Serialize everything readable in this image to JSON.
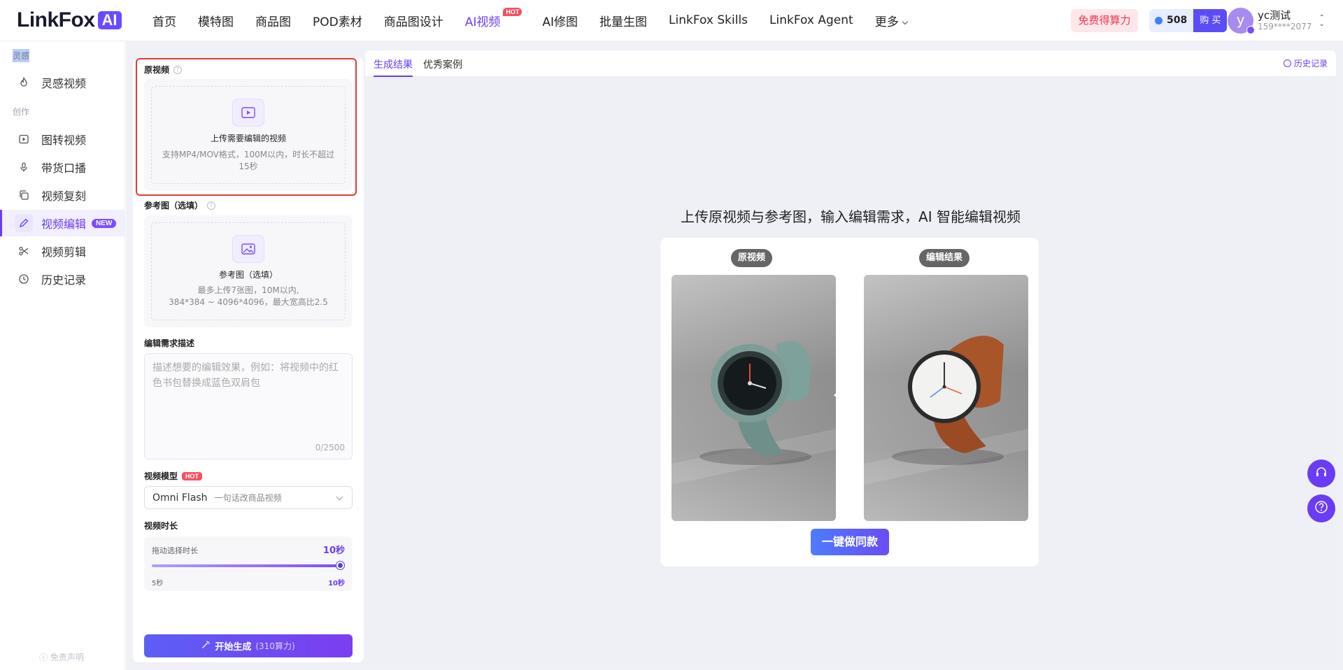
{
  "brand": {
    "name": "LinkFox",
    "badge": "AI"
  },
  "nav": {
    "items": [
      {
        "label": "首页"
      },
      {
        "label": "模特图"
      },
      {
        "label": "商品图"
      },
      {
        "label": "POD素材"
      },
      {
        "label": "商品图设计"
      },
      {
        "label": "AI视频",
        "badge": "HOT",
        "active": true
      },
      {
        "label": "AI修图"
      },
      {
        "label": "批量生图"
      },
      {
        "label": "LinkFox Skills"
      },
      {
        "label": "LinkFox Agent"
      },
      {
        "label": "更多"
      }
    ]
  },
  "header": {
    "free_label": "免费得算力",
    "credits": "508",
    "buy_label": "购 买",
    "user": {
      "initial": "y",
      "name": "yc测试",
      "phone": "159****2077"
    }
  },
  "sidebar": {
    "section_inspiration": "灵感",
    "section_create": "创作",
    "items": [
      {
        "label": "灵感视频",
        "icon": "flame-icon"
      },
      {
        "label": "图转视频",
        "icon": "play-square-icon"
      },
      {
        "label": "带货口播",
        "icon": "microphone-icon"
      },
      {
        "label": "视频复刻",
        "icon": "copy-icon"
      },
      {
        "label": "视频编辑",
        "icon": "pencil-icon",
        "badge": "NEW",
        "active": true
      },
      {
        "label": "视频剪辑",
        "icon": "scissors-icon"
      },
      {
        "label": "历史记录",
        "icon": "clock-icon"
      }
    ],
    "disclaimer": "免责声明"
  },
  "form": {
    "source_label": "原视频",
    "source_upload_title": "上传需要编辑的视频",
    "source_upload_desc": "支持MP4/MOV格式，100M以内，时长不超过15秒",
    "ref_label": "参考图（选填）",
    "ref_upload_title": "参考图（选填）",
    "ref_upload_desc_1": "最多上传7张图，10M以内,",
    "ref_upload_desc_2": "384*384 ~ 4096*4096，最大宽高比2.5",
    "desc_label": "编辑需求描述",
    "desc_placeholder": "描述想要的编辑效果，例如：将视频中的红色书包替换成蓝色双肩包",
    "desc_count": "0/2500",
    "model_label": "视频模型",
    "model_badge": "HOT",
    "model_value": "Omni Flash",
    "model_desc": "一句话改商品视频",
    "duration_label": "视频时长",
    "duration_hint": "拖动选择时长",
    "duration_value": "10秒",
    "duration_min": "5秒",
    "duration_max": "10秒",
    "duration_fraction": 1.0,
    "generate_label": "开始生成",
    "generate_cost": "(310算力)"
  },
  "result": {
    "tabs": [
      "生成结果",
      "优秀案例"
    ],
    "history_label": "历史记录",
    "headline": "上传原视频与参考图，输入编辑需求，AI 智能编辑视频",
    "before_label": "原视频",
    "after_label": "编辑结果",
    "same_label": "一键做同款"
  },
  "colors": {
    "accent": "#6b3cf5",
    "hot": "#f5515f",
    "highlight_border": "#e53935"
  }
}
